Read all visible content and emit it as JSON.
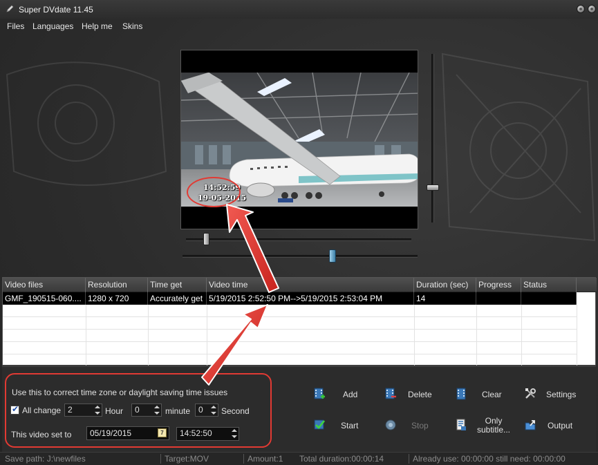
{
  "window": {
    "title": "Super DVdate  11.45"
  },
  "menu": [
    "Files",
    "Languages",
    "Help me",
    "Skins"
  ],
  "preview": {
    "overlay_time": "14:52:59",
    "overlay_date": "19-05-2015"
  },
  "table": {
    "columns": [
      "Video files",
      "Resolution",
      "Time get",
      "Video time",
      "Duration (sec)",
      "Progress",
      "Status"
    ],
    "rows": [
      {
        "file": "GMF_190515-060....",
        "resolution": "1280 x 720",
        "time_get": "Accurately get",
        "video_time": "5/19/2015 2:52:50 PM-->5/19/2015 2:53:04 PM",
        "duration": "14",
        "progress": "",
        "status": ""
      }
    ]
  },
  "correction": {
    "hint": "Use this to correct time zone or daylight saving time issues",
    "all_change_label": "All change",
    "all_change_checked": true,
    "hour_value": "2",
    "hour_label": "Hour",
    "minute_value": "0",
    "minute_label": "minute",
    "second_value": "0",
    "second_label": "Second",
    "set_to_label": "This video set to",
    "date_value": "05/19/2015",
    "calendar_day": "7",
    "time_value": "14:52:50"
  },
  "actions": {
    "add": "Add",
    "delete": "Delete",
    "clear": "Clear",
    "settings": "Settings",
    "start": "Start",
    "stop": "Stop",
    "only_subtitle_line1": "Only",
    "only_subtitle_line2": "subtitle...",
    "output": "Output"
  },
  "status": {
    "save_path": "Save path:  J:\\newfiles",
    "target": "Target:MOV",
    "amount": "Amount:1",
    "total_duration": "Total duration:00:00:14",
    "usage": "Already use: 00:00:00 still need: 00:00:00"
  },
  "colors": {
    "annotation_red": "#e23a33",
    "selected_row": "#000000",
    "background": "#2c2c2c"
  }
}
